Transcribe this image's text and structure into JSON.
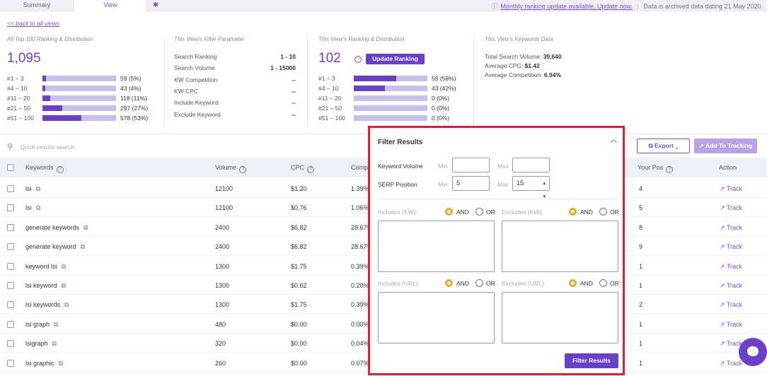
{
  "tabs": {
    "summary": "Summary",
    "view": "View",
    "gear_icon": "gear-icon"
  },
  "notice": {
    "link": "Monthly ranking update available. Update now.",
    "separator": "|",
    "archived": "Data is archived data dating 21 May 2020."
  },
  "back_link": "<< back to all views",
  "all_top": {
    "title": "All Top 100 Ranking & Distribution",
    "total": "1,095",
    "rows": [
      {
        "label": "#1 – 3",
        "value": "59 (5%)",
        "pct": 5
      },
      {
        "label": "#4 – 10",
        "value": "43 (4%)",
        "pct": 4
      },
      {
        "label": "#11 – 20",
        "value": "118 (11%)",
        "pct": 11
      },
      {
        "label": "#21 – 50",
        "value": "297 (27%)",
        "pct": 27
      },
      {
        "label": "#51 – 100",
        "value": "578 (53%)",
        "pct": 53
      }
    ]
  },
  "filter_params": {
    "title": "This View's Filter Parameter",
    "rows": [
      {
        "label": "Search Ranking",
        "value": "1 - 10"
      },
      {
        "label": "Search Volume",
        "value": "1 - 15000"
      },
      {
        "label": "KW Competition",
        "value": "--"
      },
      {
        "label": "KW CPC",
        "value": "--"
      },
      {
        "label": "Include Keyword",
        "value": "--"
      },
      {
        "label": "Exclude Keyword",
        "value": "--"
      }
    ]
  },
  "view_rank": {
    "title": "This View's Ranking & Distribution",
    "total": "102",
    "update_button": "Update Ranking",
    "rows": [
      {
        "label": "#1 – 3",
        "value": "59 (58%)",
        "pct": 58
      },
      {
        "label": "#4 – 10",
        "value": "43 (42%)",
        "pct": 42
      },
      {
        "label": "#11 – 20",
        "value": "0 (0%)",
        "pct": 0
      },
      {
        "label": "#21 – 50",
        "value": "0 (0%)",
        "pct": 0
      },
      {
        "label": "#51 – 100",
        "value": "0 (0%)",
        "pct": 0
      }
    ]
  },
  "kw_data": {
    "title": "This View's Keywords Data",
    "total_volume_label": "Total Search Volume: ",
    "total_volume": "39,640",
    "avg_cpc_label": "Average CPC: ",
    "avg_cpc": "$1.42",
    "avg_comp_label": "Average Competition: ",
    "avg_comp": "6.94%"
  },
  "search": {
    "placeholder": "Quick results search"
  },
  "toolbar": {
    "export": "Export",
    "add_tracking": "Add To Tracking"
  },
  "table": {
    "headers": {
      "keywords": "Keywords",
      "volume": "Volume",
      "cpc": "CPC",
      "comp": "Comp",
      "your_pos": "Your Pos",
      "action": "Action"
    },
    "rows": [
      {
        "keyword": "lsi",
        "volume": "12100",
        "cpc": "$1.20",
        "comp": "1.39%",
        "pos": "4",
        "action": "Track"
      },
      {
        "keyword": "lsı",
        "volume": "12100",
        "cpc": "$0.76",
        "comp": "1.06%",
        "pos": "5",
        "action": "Track"
      },
      {
        "keyword": "generate keywords",
        "volume": "2400",
        "cpc": "$6.82",
        "comp": "28.67%",
        "pos": "8",
        "action": "Track"
      },
      {
        "keyword": "generate keyword",
        "volume": "2400",
        "cpc": "$6.82",
        "comp": "28.67%",
        "pos": "9",
        "action": "Track"
      },
      {
        "keyword": "keyword lsi",
        "volume": "1300",
        "cpc": "$1.75",
        "comp": "0.39%",
        "pos": "1",
        "action": "Track"
      },
      {
        "keyword": "lsi keyword",
        "volume": "1300",
        "cpc": "$0.62",
        "comp": "0.20%",
        "pos": "1",
        "action": "Track"
      },
      {
        "keyword": "lsi keywords",
        "volume": "1300",
        "cpc": "$1.75",
        "comp": "0.39%",
        "pos": "2",
        "action": "Track"
      },
      {
        "keyword": "lsi graph",
        "volume": "480",
        "cpc": "$0.00",
        "comp": "0.00%",
        "pos": "1",
        "action": "Track"
      },
      {
        "keyword": "lsigraph",
        "volume": "320",
        "cpc": "$0.00",
        "comp": "0.04%",
        "pos": "1",
        "action": "Track"
      },
      {
        "keyword": "lsi graphic",
        "volume": "260",
        "cpc": "$0.00",
        "comp": "0.07%",
        "pos": "1",
        "action": "Track"
      }
    ]
  },
  "filter_popup": {
    "title": "Filter Results",
    "kw_volume_label": "Keyword Volume",
    "serp_label": "SERP Position",
    "min": "Min",
    "max": "Max",
    "kw_volume_min": "",
    "kw_volume_max": "",
    "serp_min": "5",
    "serp_max": "15",
    "includes_kw": "Includes (KW):",
    "excludes_kw": "Excludes (KW):",
    "includes_url": "Includes (URL):",
    "excludes_url": "Excludes (URL):",
    "and": "AND",
    "or": "OR",
    "submit": "Filter Results"
  },
  "colors": {
    "accent": "#6a3fc9",
    "accent_light": "#c9bfee",
    "highlight": "#e0202e",
    "radio_on": "#f5a623"
  }
}
